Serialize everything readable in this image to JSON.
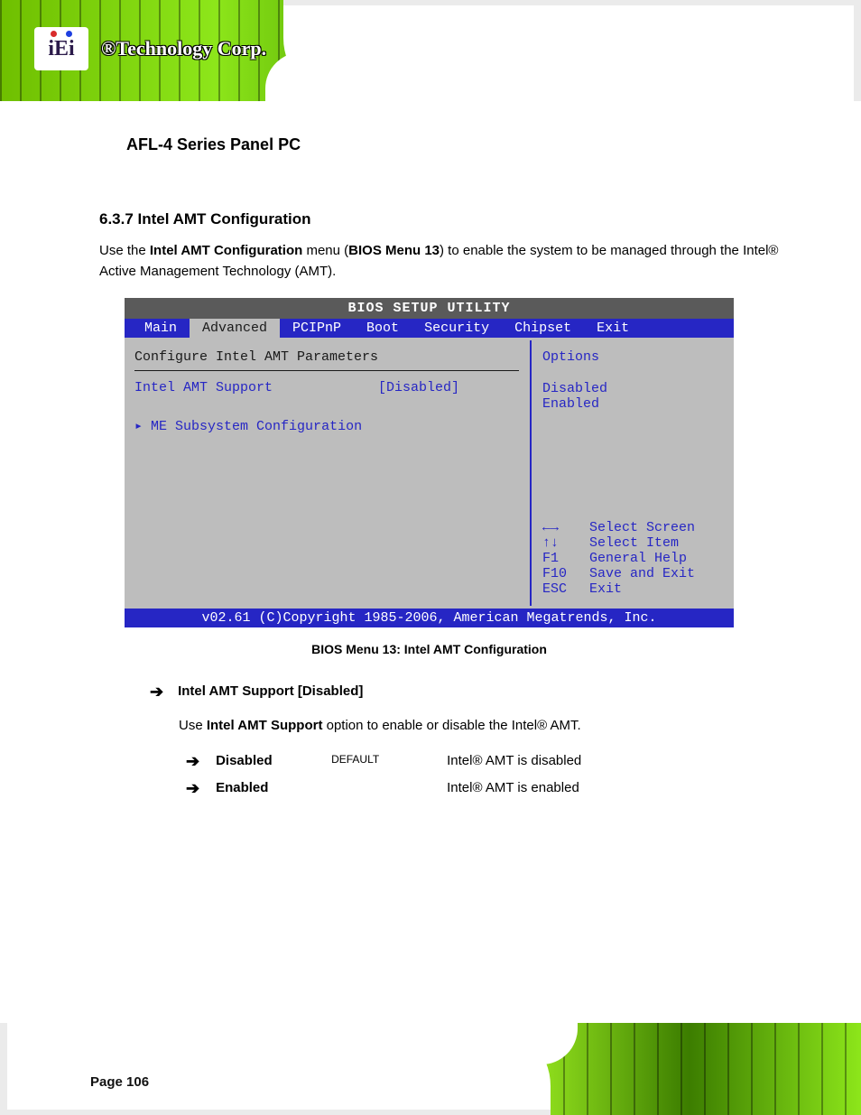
{
  "header": {
    "logo_text": "iEi",
    "brand_text": "®Technology Corp.",
    "doc_title": "AFL-4 Series Panel PC"
  },
  "section": {
    "heading": "6.3.7 Intel AMT Configuration",
    "intro_1": "Use the ",
    "intro_bold": "Intel AMT Configuration",
    "intro_2": " menu (",
    "intro_ref": "BIOS Menu 13",
    "intro_3": ") to enable the system to be managed through the Intel® Active Management Technology (AMT)."
  },
  "bios": {
    "title": "BIOS SETUP UTILITY",
    "tabs": [
      "Main",
      "Advanced",
      "PCIPnP",
      "Boot",
      "Security",
      "Chipset",
      "Exit"
    ],
    "active_tab": "Advanced",
    "left_header": "Configure Intel AMT Parameters",
    "setting_label": "Intel AMT Support",
    "setting_value": "[Disabled]",
    "submenu": "▸ ME Subsystem Configuration",
    "right_title": "Options",
    "options": [
      "Disabled",
      "Enabled"
    ],
    "nav": [
      {
        "key": "←→",
        "label": "Select Screen"
      },
      {
        "key": "↑↓",
        "label": "Select Item"
      },
      {
        "key": "F1",
        "label": "General Help"
      },
      {
        "key": "F10",
        "label": "Save and Exit"
      },
      {
        "key": "ESC",
        "label": "Exit"
      }
    ],
    "footer": "v02.61 (C)Copyright 1985-2006, American Megatrends, Inc."
  },
  "caption": "BIOS Menu 13: Intel AMT Configuration",
  "amt_item": {
    "lead": "Intel AMT Support [Disabled]",
    "desc_1": "Use ",
    "desc_bold": "Intel AMT Support",
    "desc_2": " option to enable or disable the Intel® AMT.",
    "options": [
      {
        "name": "Disabled",
        "def": "DEFAULT",
        "desc": "Intel® AMT is disabled"
      },
      {
        "name": "Enabled",
        "def": "",
        "desc": "Intel® AMT is enabled"
      }
    ]
  },
  "page_number": "Page 106"
}
